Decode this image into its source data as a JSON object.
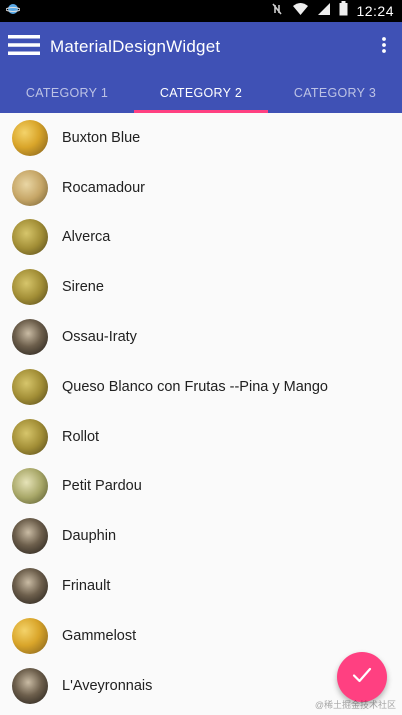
{
  "status_bar": {
    "time": "12:24",
    "icons": [
      "app-notification-icon",
      "vibrate-icon",
      "wifi-icon",
      "signal-icon",
      "battery-icon"
    ]
  },
  "app_bar": {
    "title": "MaterialDesignWidget",
    "menu_icon": "hamburger-menu-icon",
    "overflow_icon": "more-vert-icon",
    "color": "#3f51b5"
  },
  "tabs": [
    {
      "label": "CATEGORY 1",
      "active": false
    },
    {
      "label": "CATEGORY 2",
      "active": true
    },
    {
      "label": "CATEGORY 3",
      "active": false
    }
  ],
  "accent_color": "#ff4081",
  "list": {
    "items": [
      {
        "label": "Buxton Blue",
        "avatar": "yellow"
      },
      {
        "label": "Rocamadour",
        "avatar": "tan"
      },
      {
        "label": "Alverca",
        "avatar": "olive"
      },
      {
        "label": "Sirene",
        "avatar": "olive"
      },
      {
        "label": "Ossau-Iraty",
        "avatar": "dark"
      },
      {
        "label": "Queso Blanco con Frutas --Pina y Mango",
        "avatar": "olive"
      },
      {
        "label": "Rollot",
        "avatar": "olive"
      },
      {
        "label": "Petit Pardou",
        "avatar": "green"
      },
      {
        "label": "Dauphin",
        "avatar": "dark"
      },
      {
        "label": "Frinault",
        "avatar": "dark"
      },
      {
        "label": "Gammelost",
        "avatar": "yellow"
      },
      {
        "label": "L'Aveyronnais",
        "avatar": "dark"
      }
    ]
  },
  "fab": {
    "icon": "check-icon"
  },
  "watermark": "@稀土掘金技术社区"
}
